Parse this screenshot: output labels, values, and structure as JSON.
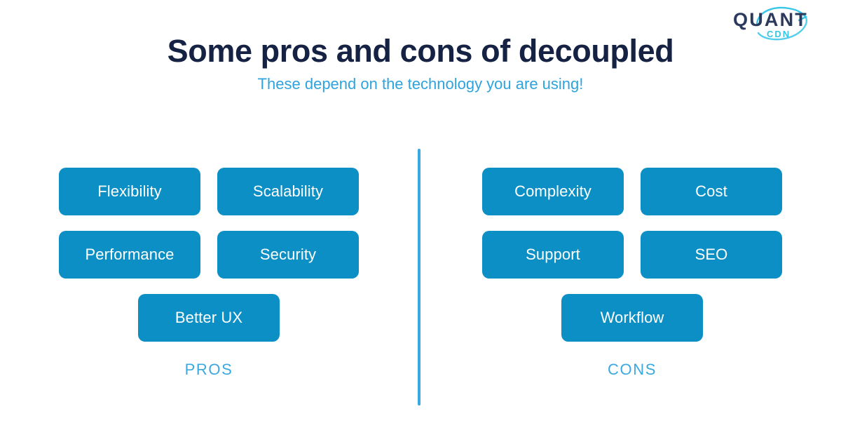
{
  "logo": {
    "wordmark": "QUANT",
    "sub": "CDN",
    "wordmark_color": "#2b3a5c",
    "sub_color": "#35c6e8",
    "arc_color": "#35c6e8"
  },
  "heading": {
    "title": "Some pros and cons of decoupled",
    "subtitle": "These depend on the technology you are using!",
    "title_color": "#152243",
    "subtitle_color": "#2ea3dd"
  },
  "theme": {
    "background": "#ffffff",
    "pill_bg": "#0b8fc5",
    "pill_text": "#ffffff",
    "divider_color": "#3aa9e0",
    "label_color": "#3aa9e0"
  },
  "columns": [
    {
      "side": "left",
      "label": "PROS",
      "rows": [
        [
          "Flexibility",
          "Scalability"
        ],
        [
          "Performance",
          "Security"
        ],
        [
          "Better UX"
        ]
      ]
    },
    {
      "side": "right",
      "label": "CONS",
      "rows": [
        [
          "Complexity",
          "Cost"
        ],
        [
          "Support",
          "SEO"
        ],
        [
          "Workflow"
        ]
      ]
    }
  ]
}
